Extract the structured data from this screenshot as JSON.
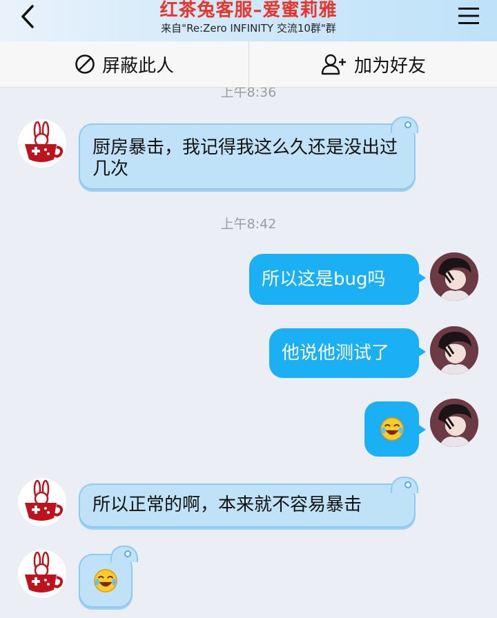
{
  "header": {
    "title": "红茶兔客服–爱蜜莉雅",
    "subtitle": "来自\"Re:Zero INFINITY 交流10群\"群"
  },
  "actions": {
    "block": "屏蔽此人",
    "add_friend": "加为好友"
  },
  "messages": {
    "time_top": "上午8:36",
    "m1": "厨房暴击，我记得我这么久还是没出过几次",
    "time_mid": "上午8:42",
    "m2": "所以这是bug吗",
    "m3": "他说他测试了",
    "m4_emoji": "laughing-tears-emoji",
    "m5": "所以正常的啊，本来就不容易暴击",
    "m6_emoji": "laughing-tears-emoji"
  },
  "colors": {
    "title": "#e8342a",
    "incoming_bubble": "#bfe2f9",
    "outgoing_bubble": "#1ab0f3",
    "background": "#eceef5"
  }
}
